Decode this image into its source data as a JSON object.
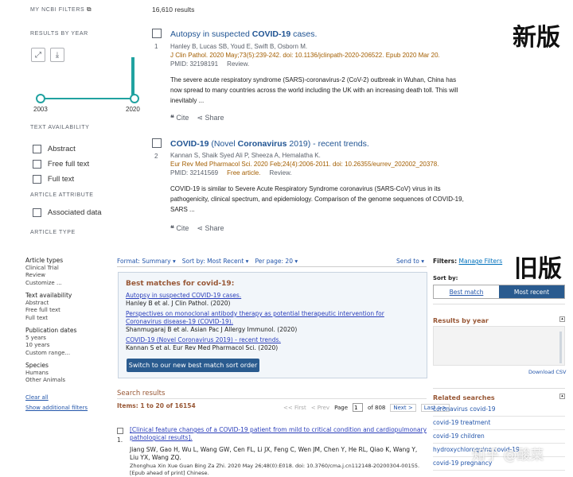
{
  "new_version": {
    "tag": "新版",
    "sidebar": {
      "my_filters": "MY NCBI FILTERS",
      "results_by_year": "RESULTS BY YEAR",
      "year_start": "2003",
      "year_end": "2020",
      "text_availability": "TEXT AVAILABILITY",
      "filters": [
        "Abstract",
        "Free full text",
        "Full text"
      ],
      "article_attribute": "ARTICLE ATTRIBUTE",
      "attribute_filters": [
        "Associated data"
      ],
      "article_type": "ARTICLE TYPE"
    },
    "result_count": "16,610 results",
    "cite_label": "Cite",
    "share_label": "Share",
    "results": [
      {
        "num": "1",
        "title_parts": [
          "Autopsy in suspected ",
          "COVID-19",
          " cases."
        ],
        "authors": "Hanley B, Lucas SB, Youd E, Swift B, Osborn M.",
        "journal": "J Clin Pathol. 2020 May;73(5):239-242. doi: 10.1136/jclinpath-2020-206522. Epub 2020 Mar 20.",
        "pmid": "PMID: 32198191",
        "type": "Review.",
        "snippet_1": "The severe acute respiratory syndrome (SARS)-coronavirus-2 (CoV-2) outbreak in Wuhan, China has",
        "snippet_2": "now spread to many countries across the world including the UK with an increasing death toll. This will",
        "snippet_3": "inevitably ..."
      },
      {
        "num": "2",
        "title_parts": [
          "COVID-19",
          " (Novel ",
          "Coronavirus",
          " 2019) - recent trends."
        ],
        "authors": "Kannan S, Shaik Syed Ali P, Sheeza A, Hemalatha K.",
        "journal": "Eur Rev Med Pharmacol Sci. 2020 Feb;24(4):2006-2011. doi: 10.26355/eurrev_202002_20378.",
        "pmid": "PMID: 32141569",
        "free": "Free article.",
        "type": "Review.",
        "snippet_1": "COVID-19 is similar to Severe Acute Respiratory Syndrome coronavirus (SARS-CoV) virus in its",
        "snippet_2": "pathogenicity, clinical spectrum, and epidemiology. Comparison of the genome sequences of COVID-19,",
        "snippet_3": "SARS ..."
      }
    ]
  },
  "old_version": {
    "tag": "旧版",
    "left": {
      "article_types": "Article types",
      "article_type_items": [
        "Clinical Trial",
        "Review",
        "Customize ..."
      ],
      "text_availability": "Text availability",
      "text_items": [
        "Abstract",
        "Free full text",
        "Full text"
      ],
      "pub_dates": "Publication dates",
      "date_items": [
        "5 years",
        "10 years",
        "Custom range..."
      ],
      "species": "Species",
      "species_items": [
        "Humans",
        "Other Animals"
      ],
      "clear_all": "Clear all",
      "show_filters": "Show additional filters"
    },
    "toolbar": {
      "format": "Format: Summary",
      "sort": "Sort by: Most Recent",
      "per_page": "Per page: 20",
      "send_to": "Send to"
    },
    "best": {
      "heading": "Best matches for covid-19:",
      "items": [
        {
          "title": "Autopsy in suspected COVID-19 cases.",
          "cite": "Hanley B et al. J Clin Pathol. (2020)"
        },
        {
          "title": "Perspectives on monoclonal antibody therapy as potential therapeutic intervention for Coronavirus disease-19 (COVID-19).",
          "cite": "Shanmugaraj B et al. Asian Pac J Allergy Immunol. (2020)"
        },
        {
          "title": "COVID-19 (Novel Coronavirus 2019) - recent trends.",
          "cite": "Kannan S et al. Eur Rev Med Pharmacol Sci. (2020)"
        }
      ],
      "switch_button": "Switch to our new best match sort order"
    },
    "search_results": "Search results",
    "items_count": "Items: 1 to 20 of 16154",
    "pager": {
      "first": "<< First",
      "prev": "< Prev",
      "page": "Page",
      "page_num": "1",
      "of": "of 808",
      "next": "Next >",
      "last": "Last >>"
    },
    "result": {
      "num": "1.",
      "title": "[Clinical feature changes of a COVID-19 patient from mild to critical condition and cardiopulmonary pathological results].",
      "authors": "Jiang SW, Gao H, Wu L, Wang GW, Cen FL, Li JX, Feng C, Wen JM, Chen Y, He RL, Qiao K, Wang Y, Liu YX, Wang ZQ.",
      "journal": "Zhonghua Xin Xue Guan Bing Za Zhi. 2020 May 26;48(0):E018. doi: 10.3760/cma.j.cn112148-20200304-00155. [Epub ahead of print] Chinese."
    },
    "right": {
      "filters": "Filters:",
      "manage": "Manage Filters",
      "sort_by": "Sort by:",
      "best_match": "Best match",
      "most_recent": "Most recent",
      "results_by_year": "Results by year",
      "download_csv": "Download CSV",
      "related": "Related searches",
      "related_items": [
        "coronavirus covid-19",
        "covid-19 treatment",
        "covid-19 children",
        "hydroxychloroquine covid-19",
        "covid-19 pregnancy"
      ]
    },
    "watermark": "知乎 @酸菜"
  }
}
